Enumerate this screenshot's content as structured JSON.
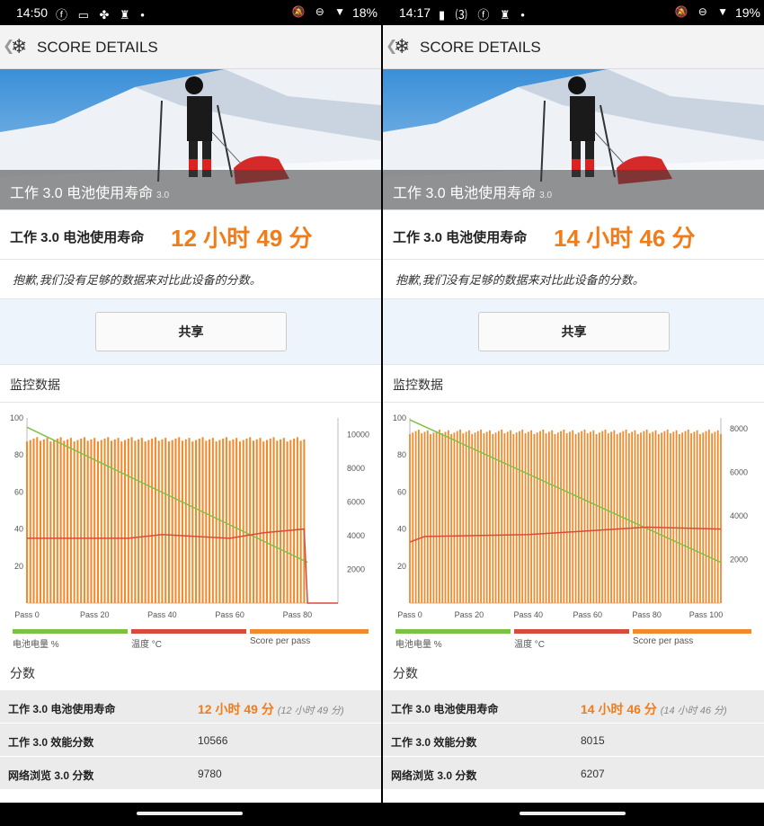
{
  "panels": [
    {
      "status": {
        "time": "14:50",
        "left_icons": "ⓕ ▭ ✤ ♜ •",
        "right_icons": "🔕 ⊖ ▼",
        "battery": "18%"
      },
      "appbar": {
        "title": "SCORE DETAILS"
      },
      "hero": {
        "caption": "工作 3.0 电池使用寿命",
        "caption_sub": "3.0"
      },
      "result": {
        "label": "工作 3.0 电池使用寿命",
        "value": "12 小时 49 分"
      },
      "note": "抱歉,我们没有足够的数据来对比此设备的分数。",
      "share_label": "共享",
      "monitor_title": "监控数据",
      "scores_title": "分数",
      "legend": {
        "battery": "电池电量 %",
        "temp": "温度 °C",
        "score": "Score per pass"
      },
      "scores": [
        {
          "k": "工作 3.0 电池使用寿命",
          "v": "12 小时 49 分",
          "paren": "(12 小时 49 分)"
        },
        {
          "k": "工作 3.0 效能分数",
          "v": "10566"
        },
        {
          "k": "网络浏览 3.0 分数",
          "v": "9780"
        }
      ]
    },
    {
      "status": {
        "time": "14:17",
        "left_icons": "▮ ⑶ ⓕ ♜ •",
        "right_icons": "🔕 ⊖ ▼",
        "battery": "19%"
      },
      "appbar": {
        "title": "SCORE DETAILS"
      },
      "hero": {
        "caption": "工作 3.0 电池使用寿命",
        "caption_sub": "3.0"
      },
      "result": {
        "label": "工作 3.0 电池使用寿命",
        "value": "14 小时 46 分"
      },
      "note": "抱歉,我们没有足够的数据来对比此设备的分数。",
      "share_label": "共享",
      "monitor_title": "监控数据",
      "scores_title": "分数",
      "legend": {
        "battery": "电池电量 %",
        "temp": "温度 °C",
        "score": "Score per pass"
      },
      "scores": [
        {
          "k": "工作 3.0 电池使用寿命",
          "v": "14 小时 46 分",
          "paren": "(14 小时 46 分)"
        },
        {
          "k": "工作 3.0 效能分数",
          "v": "8015"
        },
        {
          "k": "网络浏览 3.0 分数",
          "v": "6207"
        }
      ]
    }
  ],
  "chart_data": [
    {
      "type": "bar",
      "passes": 93,
      "x_ticks": [
        "Pass 0",
        "Pass 20",
        "Pass 40",
        "Pass 60",
        "Pass 80"
      ],
      "x_tick_values": [
        0,
        20,
        40,
        60,
        80
      ],
      "y_left_ticks": [
        20,
        40,
        60,
        80,
        100
      ],
      "y_right_ticks": [
        2000,
        4000,
        6000,
        8000,
        10000
      ],
      "y_left_range": [
        0,
        100
      ],
      "y_right_range": [
        0,
        11000
      ],
      "score_per_pass": 9900,
      "battery_start": 95,
      "battery_end": 22,
      "temp_points": [
        [
          0,
          35
        ],
        [
          30,
          35
        ],
        [
          40,
          37
        ],
        [
          60,
          35
        ],
        [
          70,
          38
        ],
        [
          82,
          40
        ],
        [
          83,
          0
        ],
        [
          93,
          0
        ]
      ],
      "colors": {
        "bars": "#f08a2c",
        "battery": "#7cc242",
        "temp": "#d84a3a"
      }
    },
    {
      "type": "bar",
      "passes": 106,
      "x_ticks": [
        "Pass 0",
        "Pass 20",
        "Pass 40",
        "Pass 60",
        "Pass 80",
        "Pass 100"
      ],
      "x_tick_values": [
        0,
        20,
        40,
        60,
        80,
        100
      ],
      "y_left_ticks": [
        20,
        40,
        60,
        80,
        100
      ],
      "y_right_ticks": [
        2000,
        4000,
        6000,
        8000
      ],
      "y_left_range": [
        0,
        100
      ],
      "y_right_range": [
        0,
        8500
      ],
      "score_per_pass": 8000,
      "battery_start": 99,
      "battery_end": 22,
      "temp_points": [
        [
          0,
          33
        ],
        [
          5,
          36
        ],
        [
          40,
          37
        ],
        [
          80,
          41
        ],
        [
          106,
          40
        ]
      ],
      "colors": {
        "bars": "#f08a2c",
        "battery": "#7cc242",
        "temp": "#d84a3a"
      }
    }
  ]
}
